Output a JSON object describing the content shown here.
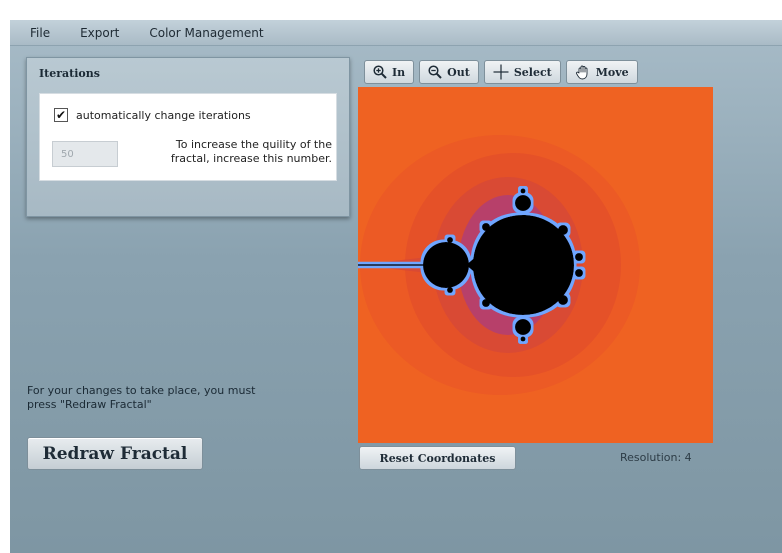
{
  "menu": {
    "items": [
      {
        "label": "File"
      },
      {
        "label": "Export"
      },
      {
        "label": "Color Management"
      }
    ]
  },
  "iterations": {
    "title": "Iterations",
    "auto_label": "automatically change iterations",
    "auto_checked": true,
    "value": "50",
    "help_line1": "To increase the quility of the",
    "help_line2": "fractal, increase this number."
  },
  "note": {
    "line1": "For your changes to take place, you must",
    "line2": "press \"Redraw Fractal\""
  },
  "redraw_label": "Redraw Fractal",
  "toolbar": {
    "zoom_in_label": "In",
    "zoom_out_label": "Out",
    "select_label": "Select",
    "move_label": "Move"
  },
  "canvas": {
    "background_color": "#ef6222",
    "set_color": "#000000",
    "edge_color": "#6fa6ff"
  },
  "reset_label": "Reset Coordonates",
  "resolution_text": "Resolution: 4"
}
